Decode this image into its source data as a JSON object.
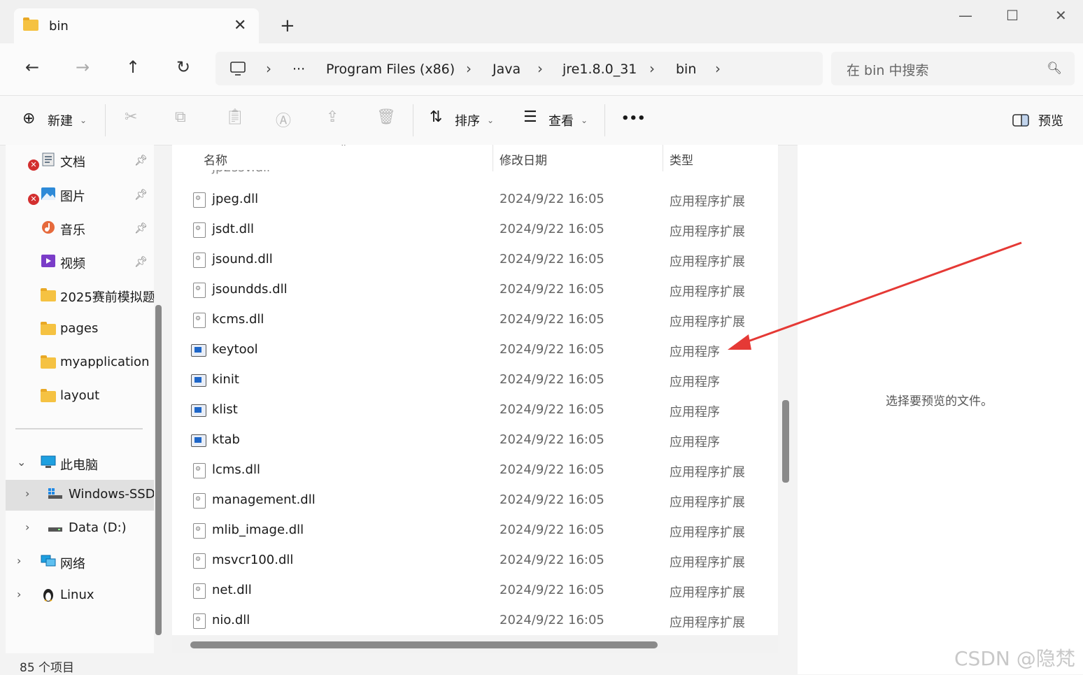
{
  "window": {
    "tab_title": "bin",
    "tab_close_icon": "close-icon",
    "new_tab_icon": "plus-icon",
    "minimize": "—",
    "maximize": "☐",
    "close": "✕"
  },
  "nav": {
    "back": "←",
    "forward": "→",
    "up": "↑",
    "refresh": "↻",
    "breadcrumbs": [
      "Program Files (x86)",
      "Java",
      "jre1.8.0_31",
      "bin"
    ],
    "overflow": "···",
    "search_placeholder": "在 bin 中搜索"
  },
  "toolbar": {
    "new_label": "新建",
    "sort_label": "排序",
    "view_label": "查看",
    "more": "•••",
    "preview_label": "预览"
  },
  "sidebar": {
    "quick_access": [
      {
        "label": "文档",
        "icon": "documents-icon",
        "pinned": true,
        "error": true
      },
      {
        "label": "图片",
        "icon": "pictures-icon",
        "pinned": true,
        "error": true
      },
      {
        "label": "音乐",
        "icon": "music-icon",
        "pinned": true
      },
      {
        "label": "视频",
        "icon": "videos-icon",
        "pinned": true
      },
      {
        "label": "2025赛前模拟题",
        "icon": "folder-icon"
      },
      {
        "label": "pages",
        "icon": "folder-icon"
      },
      {
        "label": "myapplication",
        "icon": "folder-icon"
      },
      {
        "label": "layout",
        "icon": "folder-icon"
      }
    ],
    "this_pc": "此电脑",
    "drives": [
      "Windows-SSD",
      "Data (D:)"
    ],
    "network": "网络",
    "linux": "Linux"
  },
  "columns": {
    "name": "名称",
    "modified": "修改日期",
    "type": "类型"
  },
  "files": [
    {
      "name": "jpeg.dll",
      "date": "2024/9/22 16:05",
      "type": "应用程序扩展",
      "kind": "dll"
    },
    {
      "name": "jsdt.dll",
      "date": "2024/9/22 16:05",
      "type": "应用程序扩展",
      "kind": "dll"
    },
    {
      "name": "jsound.dll",
      "date": "2024/9/22 16:05",
      "type": "应用程序扩展",
      "kind": "dll"
    },
    {
      "name": "jsoundds.dll",
      "date": "2024/9/22 16:05",
      "type": "应用程序扩展",
      "kind": "dll"
    },
    {
      "name": "kcms.dll",
      "date": "2024/9/22 16:05",
      "type": "应用程序扩展",
      "kind": "dll"
    },
    {
      "name": "keytool",
      "date": "2024/9/22 16:05",
      "type": "应用程序",
      "kind": "exe"
    },
    {
      "name": "kinit",
      "date": "2024/9/22 16:05",
      "type": "应用程序",
      "kind": "exe"
    },
    {
      "name": "klist",
      "date": "2024/9/22 16:05",
      "type": "应用程序",
      "kind": "exe"
    },
    {
      "name": "ktab",
      "date": "2024/9/22 16:05",
      "type": "应用程序",
      "kind": "exe"
    },
    {
      "name": "lcms.dll",
      "date": "2024/9/22 16:05",
      "type": "应用程序扩展",
      "kind": "dll"
    },
    {
      "name": "management.dll",
      "date": "2024/9/22 16:05",
      "type": "应用程序扩展",
      "kind": "dll"
    },
    {
      "name": "mlib_image.dll",
      "date": "2024/9/22 16:05",
      "type": "应用程序扩展",
      "kind": "dll"
    },
    {
      "name": "msvcr100.dll",
      "date": "2024/9/22 16:05",
      "type": "应用程序扩展",
      "kind": "dll"
    },
    {
      "name": "net.dll",
      "date": "2024/9/22 16:05",
      "type": "应用程序扩展",
      "kind": "dll"
    },
    {
      "name": "nio.dll",
      "date": "2024/9/22 16:05",
      "type": "应用程序扩展",
      "kind": "dll"
    }
  ],
  "preview_message": "选择要预览的文件。",
  "status": "85 个项目",
  "watermark": "CSDN @隐梵",
  "annotation_color": "#e53935"
}
